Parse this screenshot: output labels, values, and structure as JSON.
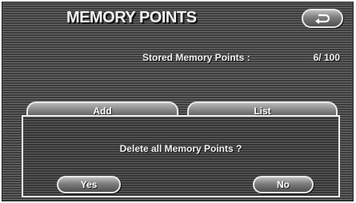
{
  "header": {
    "title": "MEMORY POINTS",
    "back_icon": "return-arrow-icon"
  },
  "stored": {
    "label": "Stored Memory Points :",
    "value": "6/ 100"
  },
  "tabs": [
    {
      "label": "Add"
    },
    {
      "label": "List"
    }
  ],
  "dialog": {
    "message": "Delete all Memory Points ?",
    "yes_label": "Yes",
    "no_label": "No"
  }
}
